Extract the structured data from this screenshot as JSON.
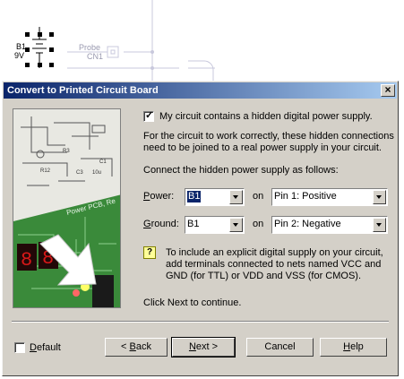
{
  "background": {
    "component_ref": "B1",
    "component_value": "9V",
    "probe_label": "Probe",
    "probe_ref": "CN1"
  },
  "dialog": {
    "title": "Convert to Printed Circuit Board",
    "close_glyph": "×",
    "hidden_supply_checkbox": {
      "label": "My circuit contains a hidden digital power supply.",
      "checked": true
    },
    "explanation": [
      "For the circuit to work correctly, these hidden connections",
      "need to be joined to a real power supply in your circuit."
    ],
    "connect_heading": "Connect the hidden power supply as follows:",
    "power": {
      "label_underlined": "P",
      "label_rest": "ower:",
      "net": "B1",
      "on": "on",
      "pin": "Pin 1: Positive"
    },
    "ground": {
      "label_underlined": "G",
      "label_rest": "round:",
      "net": "B1",
      "on": "on",
      "pin": "Pin 2: Negative"
    },
    "hint": [
      "To include an explicit digital supply on your circuit,",
      "add terminals connected to nets named VCC and",
      "GND (for TTL) or VDD and VSS (for CMOS)."
    ],
    "continue_text": "Click Next to continue.",
    "default_checkbox": {
      "label_underlined": "D",
      "label_rest": "efault",
      "checked": false
    },
    "buttons": {
      "back": {
        "prefix": "< ",
        "underlined": "B",
        "rest": "ack"
      },
      "next": {
        "underlined": "N",
        "rest": "ext >"
      },
      "cancel": "Cancel",
      "help": {
        "underlined": "H",
        "rest": "elp"
      }
    },
    "illustration": {
      "board_text": "Power PCB, Re",
      "labels": [
        "C1",
        "C3",
        "10u",
        "R3",
        "R12"
      ]
    }
  },
  "colors": {
    "title_start": "#0a246a",
    "title_end": "#a6caf0",
    "dialog_face": "#d4d0c8",
    "pcb_green": "#3a8a3a"
  }
}
